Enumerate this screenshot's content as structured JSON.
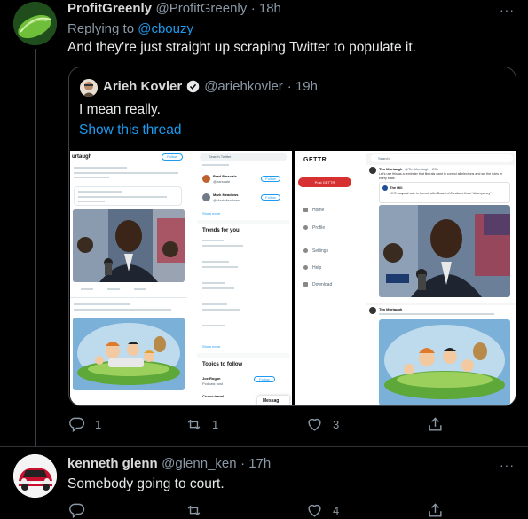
{
  "tweet1": {
    "name": "ProfitGreenly",
    "handle": "@ProfitGreenly",
    "time": "· 18h",
    "replying_prefix": "Replying to ",
    "replying_to": "@cbouzy",
    "text": "And they're just straight up scraping Twitter to populate it.",
    "more": "···",
    "actions": {
      "reply_count": "1",
      "retweet_count": "1",
      "like_count": "3"
    }
  },
  "quote": {
    "name": "Arieh Kovler",
    "handle": "@ariehkovler",
    "time": "· 19h",
    "text": "I mean really.",
    "show_thread": "Show this thread",
    "media": {
      "left": {
        "header_text": "urtaugh",
        "follow_label": "Follow",
        "search_placeholder": "Search Twitter",
        "follow_btn": "Follow",
        "trends_title": "Trends for you",
        "show_more": "Show more",
        "topics_title": "Topics to follow",
        "topic1": "Joe Rogan",
        "topic1_sub": "Podcast host",
        "topic2": "Cruise travel",
        "messages_label": "Messag",
        "suggested": [
          {
            "name": "Brad Parscale",
            "handle": "@parscale"
          },
          {
            "name": "Mark Meadows",
            "handle": "@MarkMeadows"
          }
        ]
      },
      "right": {
        "logo": "GETTR",
        "post_button": "Post GETTR",
        "nav": [
          "Home",
          "Profile",
          "Settings",
          "Help",
          "Download"
        ],
        "search_placeholder": "Search",
        "poster": "Tim Murtaugh",
        "poster_handle": "@TimMurtaugh · 23h",
        "post_text": "Let's use this as a reminder that liberals want to control all elections and set the rules in every state.",
        "quoted_source": "The Hill",
        "quoted_text": "NYC mayoral vote in turmoil after Board of Elections finds \"discrepancy\""
      }
    }
  },
  "tweet2": {
    "name": "kenneth glenn",
    "handle": "@glenn_ken",
    "time": "· 17h",
    "text": "Somebody going to court.",
    "more": "···",
    "actions": {
      "reply_count": "",
      "retweet_count": "",
      "like_count": "4"
    }
  },
  "colors": {
    "accent": "#1d9bf0",
    "background": "#000000",
    "muted": "#8b98a5",
    "border": "#2f3336"
  }
}
